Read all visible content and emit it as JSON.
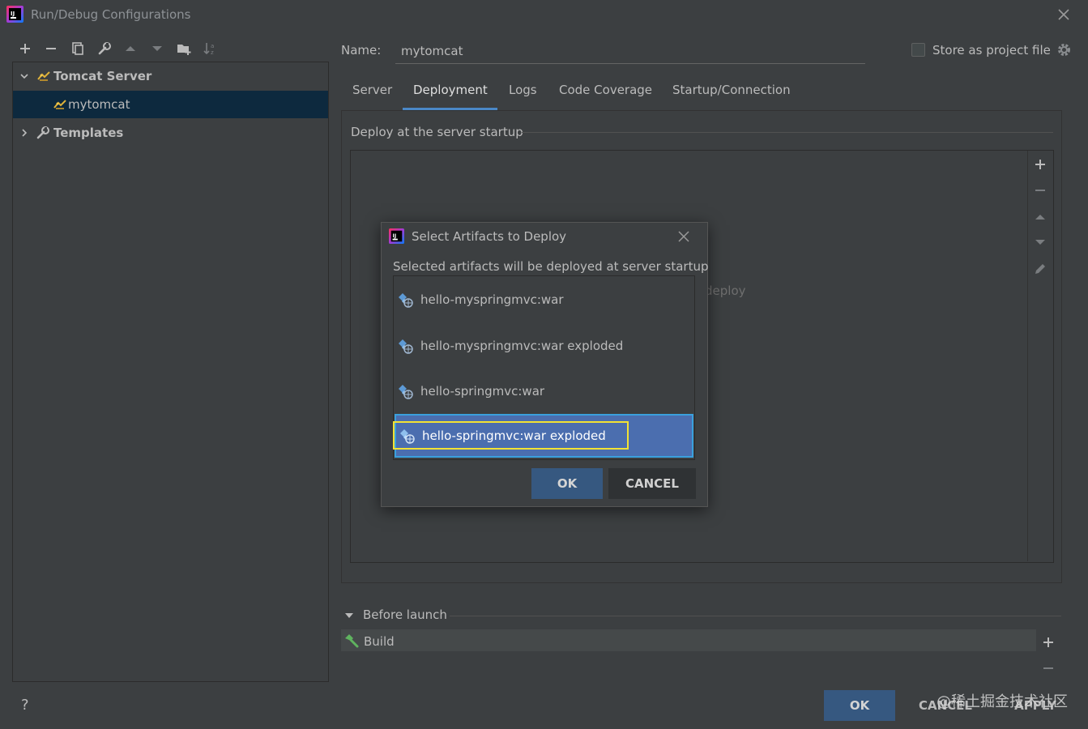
{
  "window": {
    "title": "Run/Debug Configurations"
  },
  "toolbar": {
    "buttons": [
      "add-icon",
      "remove-icon",
      "copy-icon",
      "wrench-icon",
      "move-up-icon",
      "move-down-icon",
      "folder-icon",
      "sort-icon"
    ]
  },
  "tree": {
    "group": "Tomcat Server",
    "child": "mytomcat",
    "templates": "Templates"
  },
  "config": {
    "name_label": "Name:",
    "name_value": "mytomcat",
    "store_label": "Store as project file"
  },
  "tabs": [
    {
      "label": "Server"
    },
    {
      "label": "Deployment",
      "active": true
    },
    {
      "label": "Logs"
    },
    {
      "label": "Code Coverage"
    },
    {
      "label": "Startup/Connection"
    }
  ],
  "deployment": {
    "section_title": "Deploy at the server startup",
    "empty_hint": "deploy"
  },
  "before_launch": {
    "title": "Before launch",
    "items": [
      "Build"
    ]
  },
  "footer": {
    "help": "?",
    "ok": "OK",
    "cancel": "CANCEL",
    "apply": "APPLY",
    "watermark": "@稀土掘金技术社区"
  },
  "modal": {
    "title": "Select Artifacts to Deploy",
    "subtitle": "Selected artifacts will be deployed at server startup",
    "artifacts": [
      "hello-myspringmvc:war",
      "hello-myspringmvc:war exploded",
      "hello-springmvc:war",
      "hello-springmvc:war exploded"
    ],
    "selected_index": 3,
    "ok": "OK",
    "cancel": "CANCEL"
  },
  "colors": {
    "background": "#3c3f41",
    "selection_dark": "#0d293e",
    "selection_list": "#4b6eaf",
    "button_primary": "#365880",
    "highlight": "#f2e234",
    "tab_underline": "#4a88c7"
  }
}
